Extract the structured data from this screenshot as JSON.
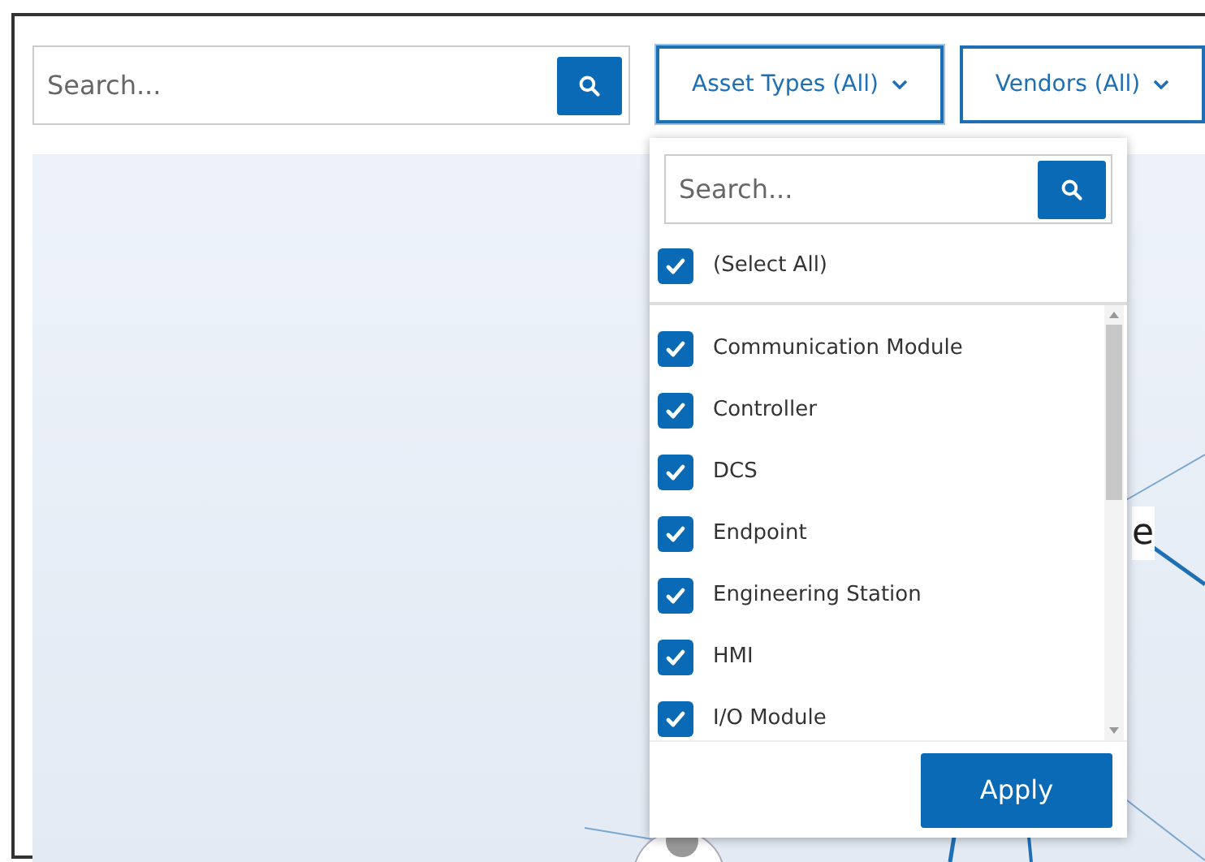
{
  "search": {
    "placeholder": "Search..."
  },
  "filters": [
    {
      "label": "Asset Types (All)",
      "expanded": true
    },
    {
      "label": "Vendors (All)",
      "expanded": false
    }
  ],
  "graph": {
    "label_fragment": "e"
  },
  "dropdown": {
    "search": {
      "placeholder": "Search..."
    },
    "select_all": {
      "label": "(Select All)",
      "checked": true
    },
    "items": [
      {
        "label": "Communication Module",
        "checked": true
      },
      {
        "label": "Controller",
        "checked": true
      },
      {
        "label": "DCS",
        "checked": true
      },
      {
        "label": "Endpoint",
        "checked": true
      },
      {
        "label": "Engineering Station",
        "checked": true
      },
      {
        "label": "HMI",
        "checked": true
      },
      {
        "label": "I/O Module",
        "checked": true
      }
    ],
    "apply": "Apply"
  }
}
